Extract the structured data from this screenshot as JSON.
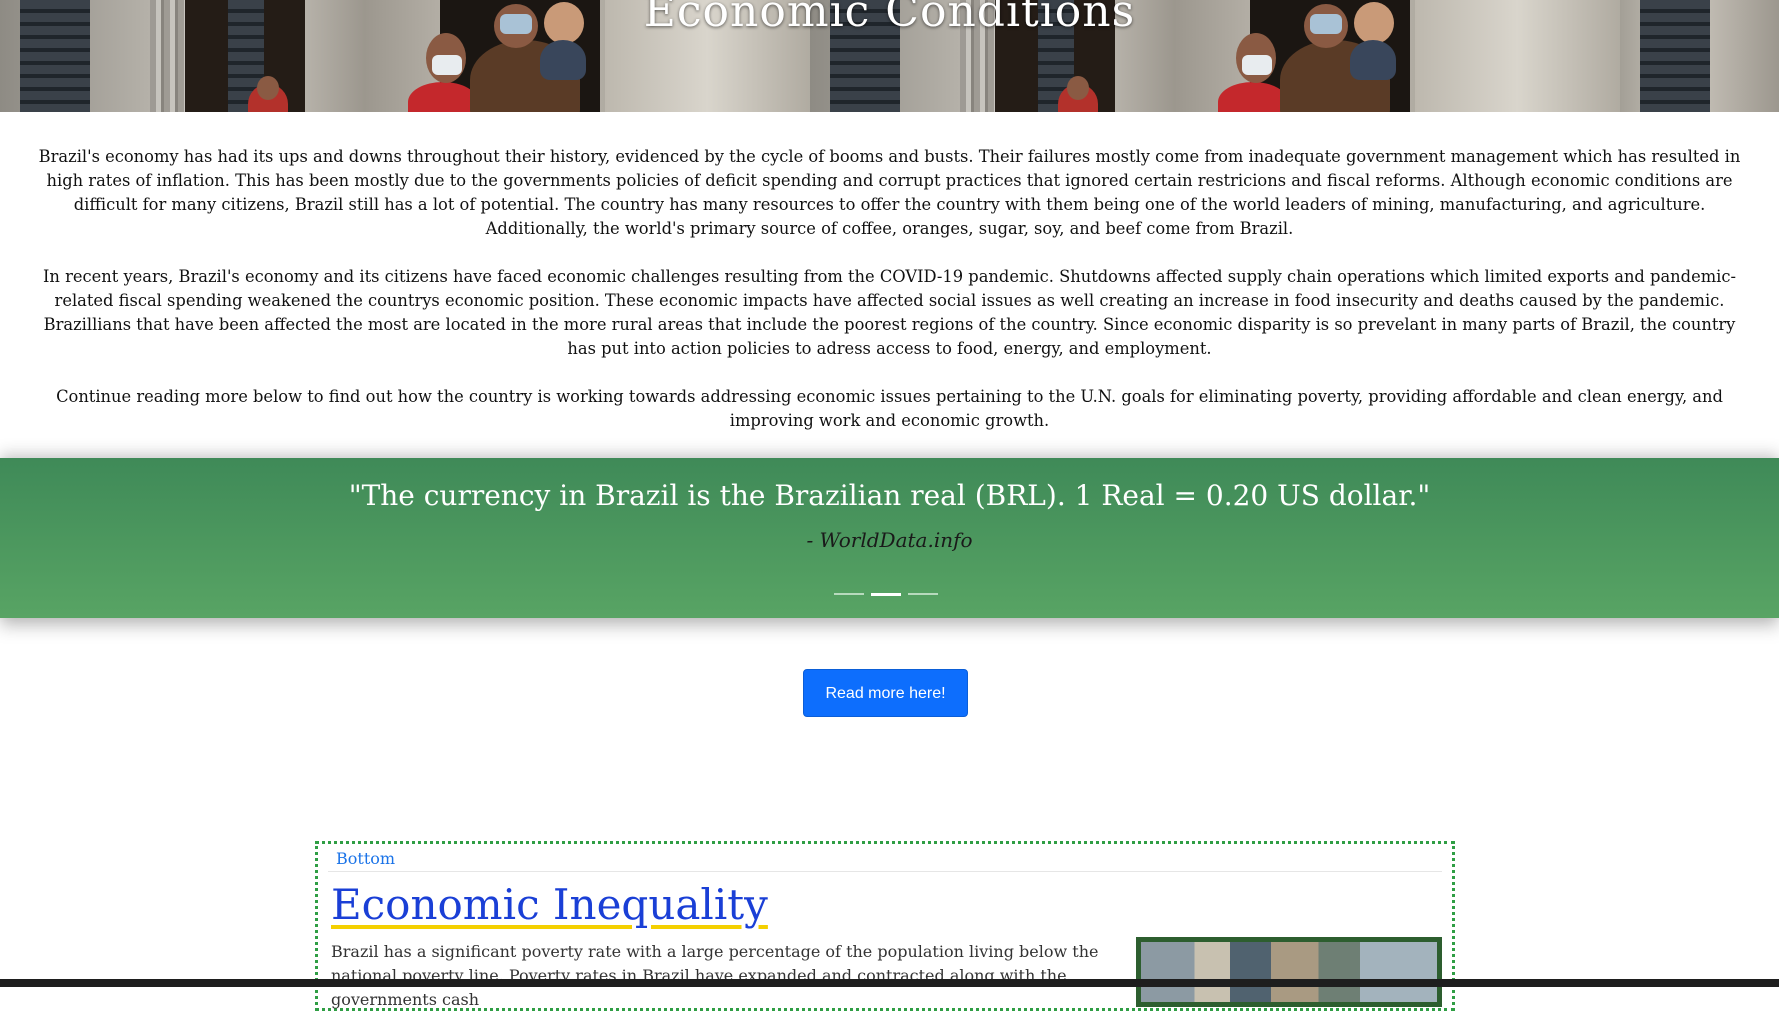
{
  "hero": {
    "title": "Economic Conditions"
  },
  "intro": {
    "paragraphs": [
      "Brazil's economy has had its ups and downs throughout their history, evidenced by the cycle of booms and busts. Their failures mostly come from inadequate government management which has resulted in high rates of inflation. This has been mostly due to the governments policies of deficit spending and corrupt practices that ignored certain restricions and fiscal reforms. Although economic conditions are difficult for many citizens, Brazil still has a lot of potential. The country has many resources to offer the country with them being one of the world leaders of mining, manufacturing, and agriculture. Additionally, the world's primary source of coffee, oranges, sugar, soy, and beef come from Brazil.",
      "In recent years, Brazil's economy and its citizens have faced economic challenges resulting from the COVID-19 pandemic. Shutdowns affected supply chain operations which limited exports and pandemic-related fiscal spending weakened the countrys economic position. These economic impacts have affected social issues as well creating an increase in food insecurity and deaths caused by the pandemic. Brazillians that have been affected the most are located in the more rural areas that include the poorest regions of the country. Since economic disparity is so prevelant in many parts of Brazil, the country has put into action policies to adress access to food, energy, and employment.",
      "Continue reading more below to find out how the country is working towards addressing economic issues pertaining to the U.N. goals for eliminating poverty, providing affordable and clean energy, and improving work and economic growth."
    ]
  },
  "carousel": {
    "quote": "\"The currency in Brazil is the Brazilian real (BRL). 1 Real = 0.20 US dollar.\"",
    "source": "- WorldData.info",
    "slide_count": 3,
    "active_slide": 2,
    "background_color": "#4a955c"
  },
  "read_more_button": {
    "label": "Read more here!",
    "color": "#0d6efd"
  },
  "section": {
    "bottom_link": "Bottom",
    "title": "Economic Inequality",
    "text": "Brazil has a significant poverty rate with a large percentage of the population living below the national poverty line. Poverty rates in Brazil have expanded and contracted along with the governments cash",
    "border_color": "#2f9e44",
    "title_underline_color": "#f4d000"
  }
}
